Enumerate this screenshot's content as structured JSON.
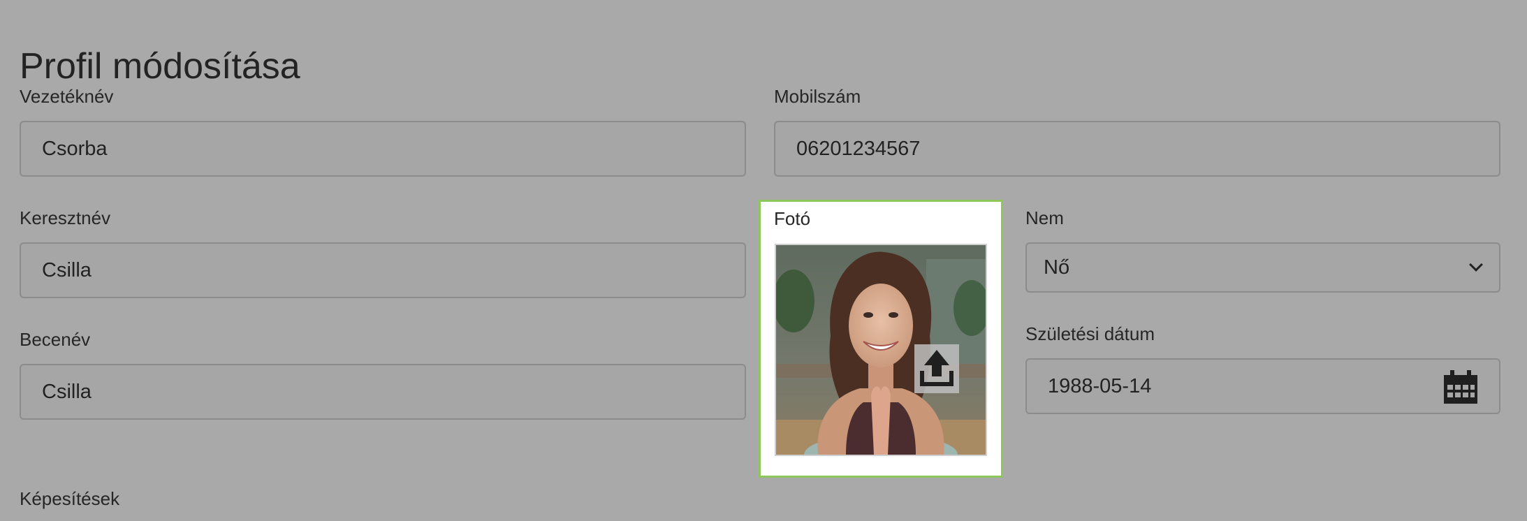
{
  "page": {
    "title": "Profil módosítása"
  },
  "form": {
    "last_name": {
      "label": "Vezetéknév",
      "value": "Csorba"
    },
    "first_name": {
      "label": "Keresztnév",
      "value": "Csilla"
    },
    "nickname": {
      "label": "Becenév",
      "value": "Csilla"
    },
    "qualifications": {
      "label": "Képesítések"
    },
    "mobile": {
      "label": "Mobilszám",
      "value": "06201234567"
    },
    "photo": {
      "label": "Fotó"
    },
    "gender": {
      "label": "Nem",
      "value": "Nő"
    },
    "birth_date": {
      "label": "Születési dátum",
      "value": "1988-05-14"
    }
  },
  "icons": {
    "upload": "upload-icon",
    "calendar": "calendar-icon",
    "chevron": "chevron-down-icon"
  },
  "colors": {
    "background": "#a9a9a9",
    "photo_card_border": "#8dc65a",
    "photo_card_background": "#ffffff"
  }
}
